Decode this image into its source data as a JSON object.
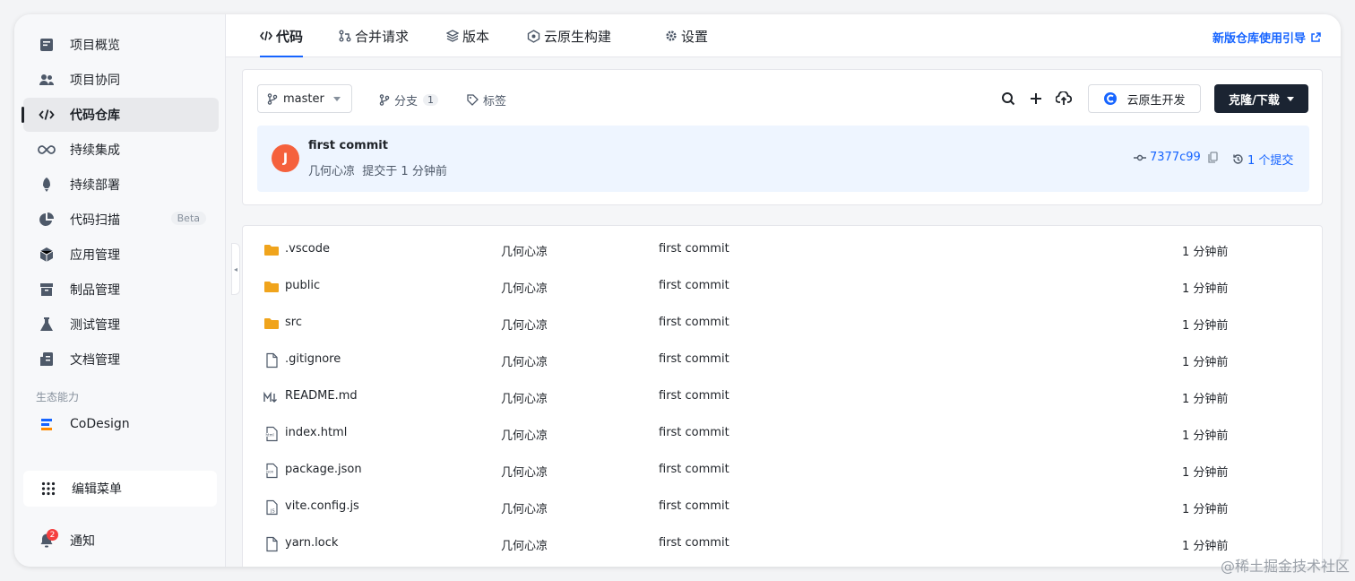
{
  "sidebar": {
    "items": [
      {
        "label": "项目概览",
        "icon": "overview-icon"
      },
      {
        "label": "项目协同",
        "icon": "team-icon"
      },
      {
        "label": "代码仓库",
        "icon": "code-icon",
        "active": true
      },
      {
        "label": "持续集成",
        "icon": "infinity-icon"
      },
      {
        "label": "持续部署",
        "icon": "rocket-icon"
      },
      {
        "label": "代码扫描",
        "icon": "pie-icon",
        "badge": "Beta"
      },
      {
        "label": "应用管理",
        "icon": "cube-icon"
      },
      {
        "label": "制品管理",
        "icon": "box-icon"
      },
      {
        "label": "测试管理",
        "icon": "flask-icon"
      },
      {
        "label": "文档管理",
        "icon": "doc-icon"
      }
    ],
    "section_ecosystem": "生态能力",
    "codesign": "CoDesign",
    "edit_menu": "编辑菜单",
    "notify": "通知",
    "notify_count": "2"
  },
  "tabs": [
    {
      "label": "代码",
      "icon": "code-icon"
    },
    {
      "label": "合并请求",
      "icon": "merge-icon"
    },
    {
      "label": "版本",
      "icon": "layers-icon"
    },
    {
      "label": "云原生构建",
      "icon": "cloud-build-icon"
    },
    {
      "label": "设置",
      "icon": "gear-icon"
    }
  ],
  "guide_link": "新版仓库使用引导",
  "toolbar": {
    "branch": "master",
    "branches_label": "分支",
    "branches_count": "1",
    "tags_label": "标签",
    "cloud_dev": "云原生开发",
    "clone": "克隆/下载"
  },
  "commit": {
    "avatar": "J",
    "title": "first commit",
    "author": "几何心凉",
    "time": "提交于 1 分钟前",
    "hash": "7377c99",
    "count": "1 个提交"
  },
  "files": [
    {
      "name": ".vscode",
      "type": "folder",
      "author": "几何心凉",
      "msg": "first commit",
      "time": "1 分钟前"
    },
    {
      "name": "public",
      "type": "folder",
      "author": "几何心凉",
      "msg": "first commit",
      "time": "1 分钟前"
    },
    {
      "name": "src",
      "type": "folder",
      "author": "几何心凉",
      "msg": "first commit",
      "time": "1 分钟前"
    },
    {
      "name": ".gitignore",
      "type": "file",
      "author": "几何心凉",
      "msg": "first commit",
      "time": "1 分钟前"
    },
    {
      "name": "README.md",
      "type": "md",
      "author": "几何心凉",
      "msg": "first commit",
      "time": "1 分钟前"
    },
    {
      "name": "index.html",
      "type": "html",
      "author": "几何心凉",
      "msg": "first commit",
      "time": "1 分钟前"
    },
    {
      "name": "package.json",
      "type": "json",
      "author": "几何心凉",
      "msg": "first commit",
      "time": "1 分钟前"
    },
    {
      "name": "vite.config.js",
      "type": "js",
      "author": "几何心凉",
      "msg": "first commit",
      "time": "1 分钟前"
    },
    {
      "name": "yarn.lock",
      "type": "file",
      "author": "几何心凉",
      "msg": "first commit",
      "time": "1 分钟前"
    }
  ],
  "watermark": "@稀土掘金技术社区",
  "colors": {
    "accent": "#1664ff",
    "avatar": "#f5613d",
    "folder": "#f0a41c",
    "dark_button": "#1b2432"
  }
}
